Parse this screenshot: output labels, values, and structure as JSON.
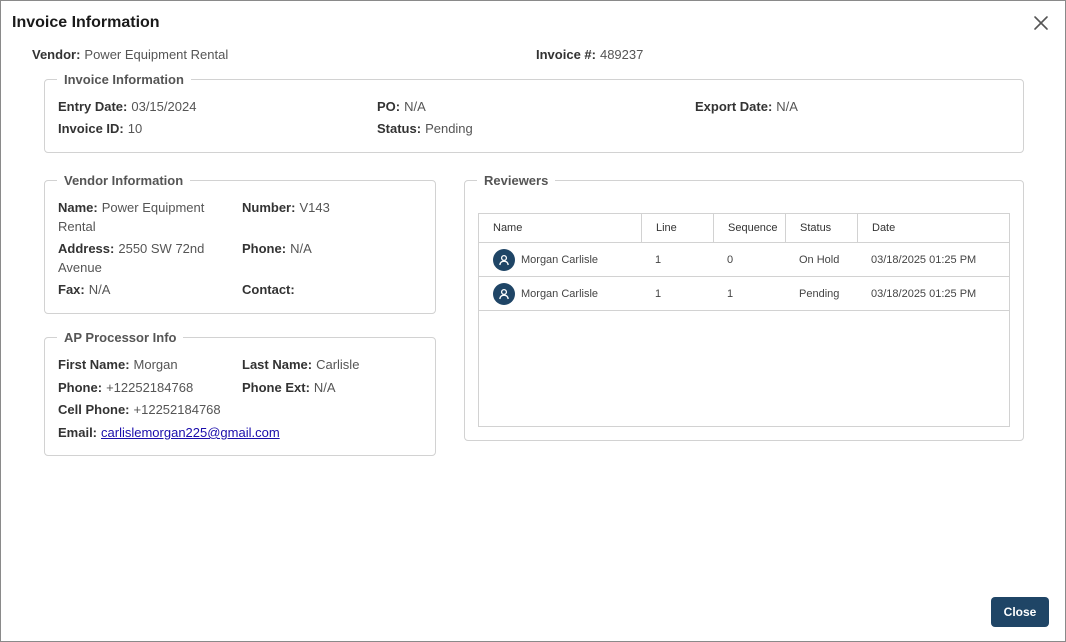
{
  "dialog": {
    "title": "Invoice Information",
    "close_button": "Close"
  },
  "summary": {
    "vendor_label": "Vendor:",
    "vendor_value": "Power Equipment Rental",
    "invoice_no_label": "Invoice #:",
    "invoice_no_value": "489237"
  },
  "invoice_info": {
    "legend": "Invoice Information",
    "entry_date_label": "Entry Date:",
    "entry_date_value": "03/15/2024",
    "po_label": "PO:",
    "po_value": "N/A",
    "export_date_label": "Export Date:",
    "export_date_value": "N/A",
    "invoice_id_label": "Invoice ID:",
    "invoice_id_value": "10",
    "status_label": "Status:",
    "status_value": "Pending"
  },
  "vendor_info": {
    "legend": "Vendor Information",
    "name_label": "Name:",
    "name_value": "Power Equipment Rental",
    "number_label": "Number:",
    "number_value": "V143",
    "address_label": "Address:",
    "address_value": "2550 SW 72nd Avenue",
    "phone_label": "Phone:",
    "phone_value": "N/A",
    "fax_label": "Fax:",
    "fax_value": "N/A",
    "contact_label": "Contact:",
    "contact_value": ""
  },
  "ap_processor": {
    "legend": "AP Processor Info",
    "first_name_label": "First Name:",
    "first_name_value": "Morgan",
    "last_name_label": "Last Name:",
    "last_name_value": "Carlisle",
    "phone_label": "Phone:",
    "phone_value": "+12252184768",
    "phone_ext_label": "Phone Ext:",
    "phone_ext_value": "N/A",
    "cell_phone_label": "Cell Phone:",
    "cell_phone_value": "+12252184768",
    "email_label": "Email:",
    "email_value": "carlislemorgan225@gmail.com"
  },
  "reviewers": {
    "legend": "Reviewers",
    "columns": [
      "Name",
      "Line",
      "Sequence",
      "Status",
      "Date"
    ],
    "rows": [
      {
        "name": "Morgan Carlisle",
        "line": "1",
        "sequence": "0",
        "status": "On Hold",
        "date": "03/18/2025 01:25 PM"
      },
      {
        "name": "Morgan Carlisle",
        "line": "1",
        "sequence": "1",
        "status": "Pending",
        "date": "03/18/2025 01:25 PM"
      }
    ]
  },
  "colors": {
    "primary": "#1f4566",
    "border": "#d2d2d2"
  },
  "icons": {
    "close": "close-icon",
    "avatar": "user-avatar-icon"
  }
}
